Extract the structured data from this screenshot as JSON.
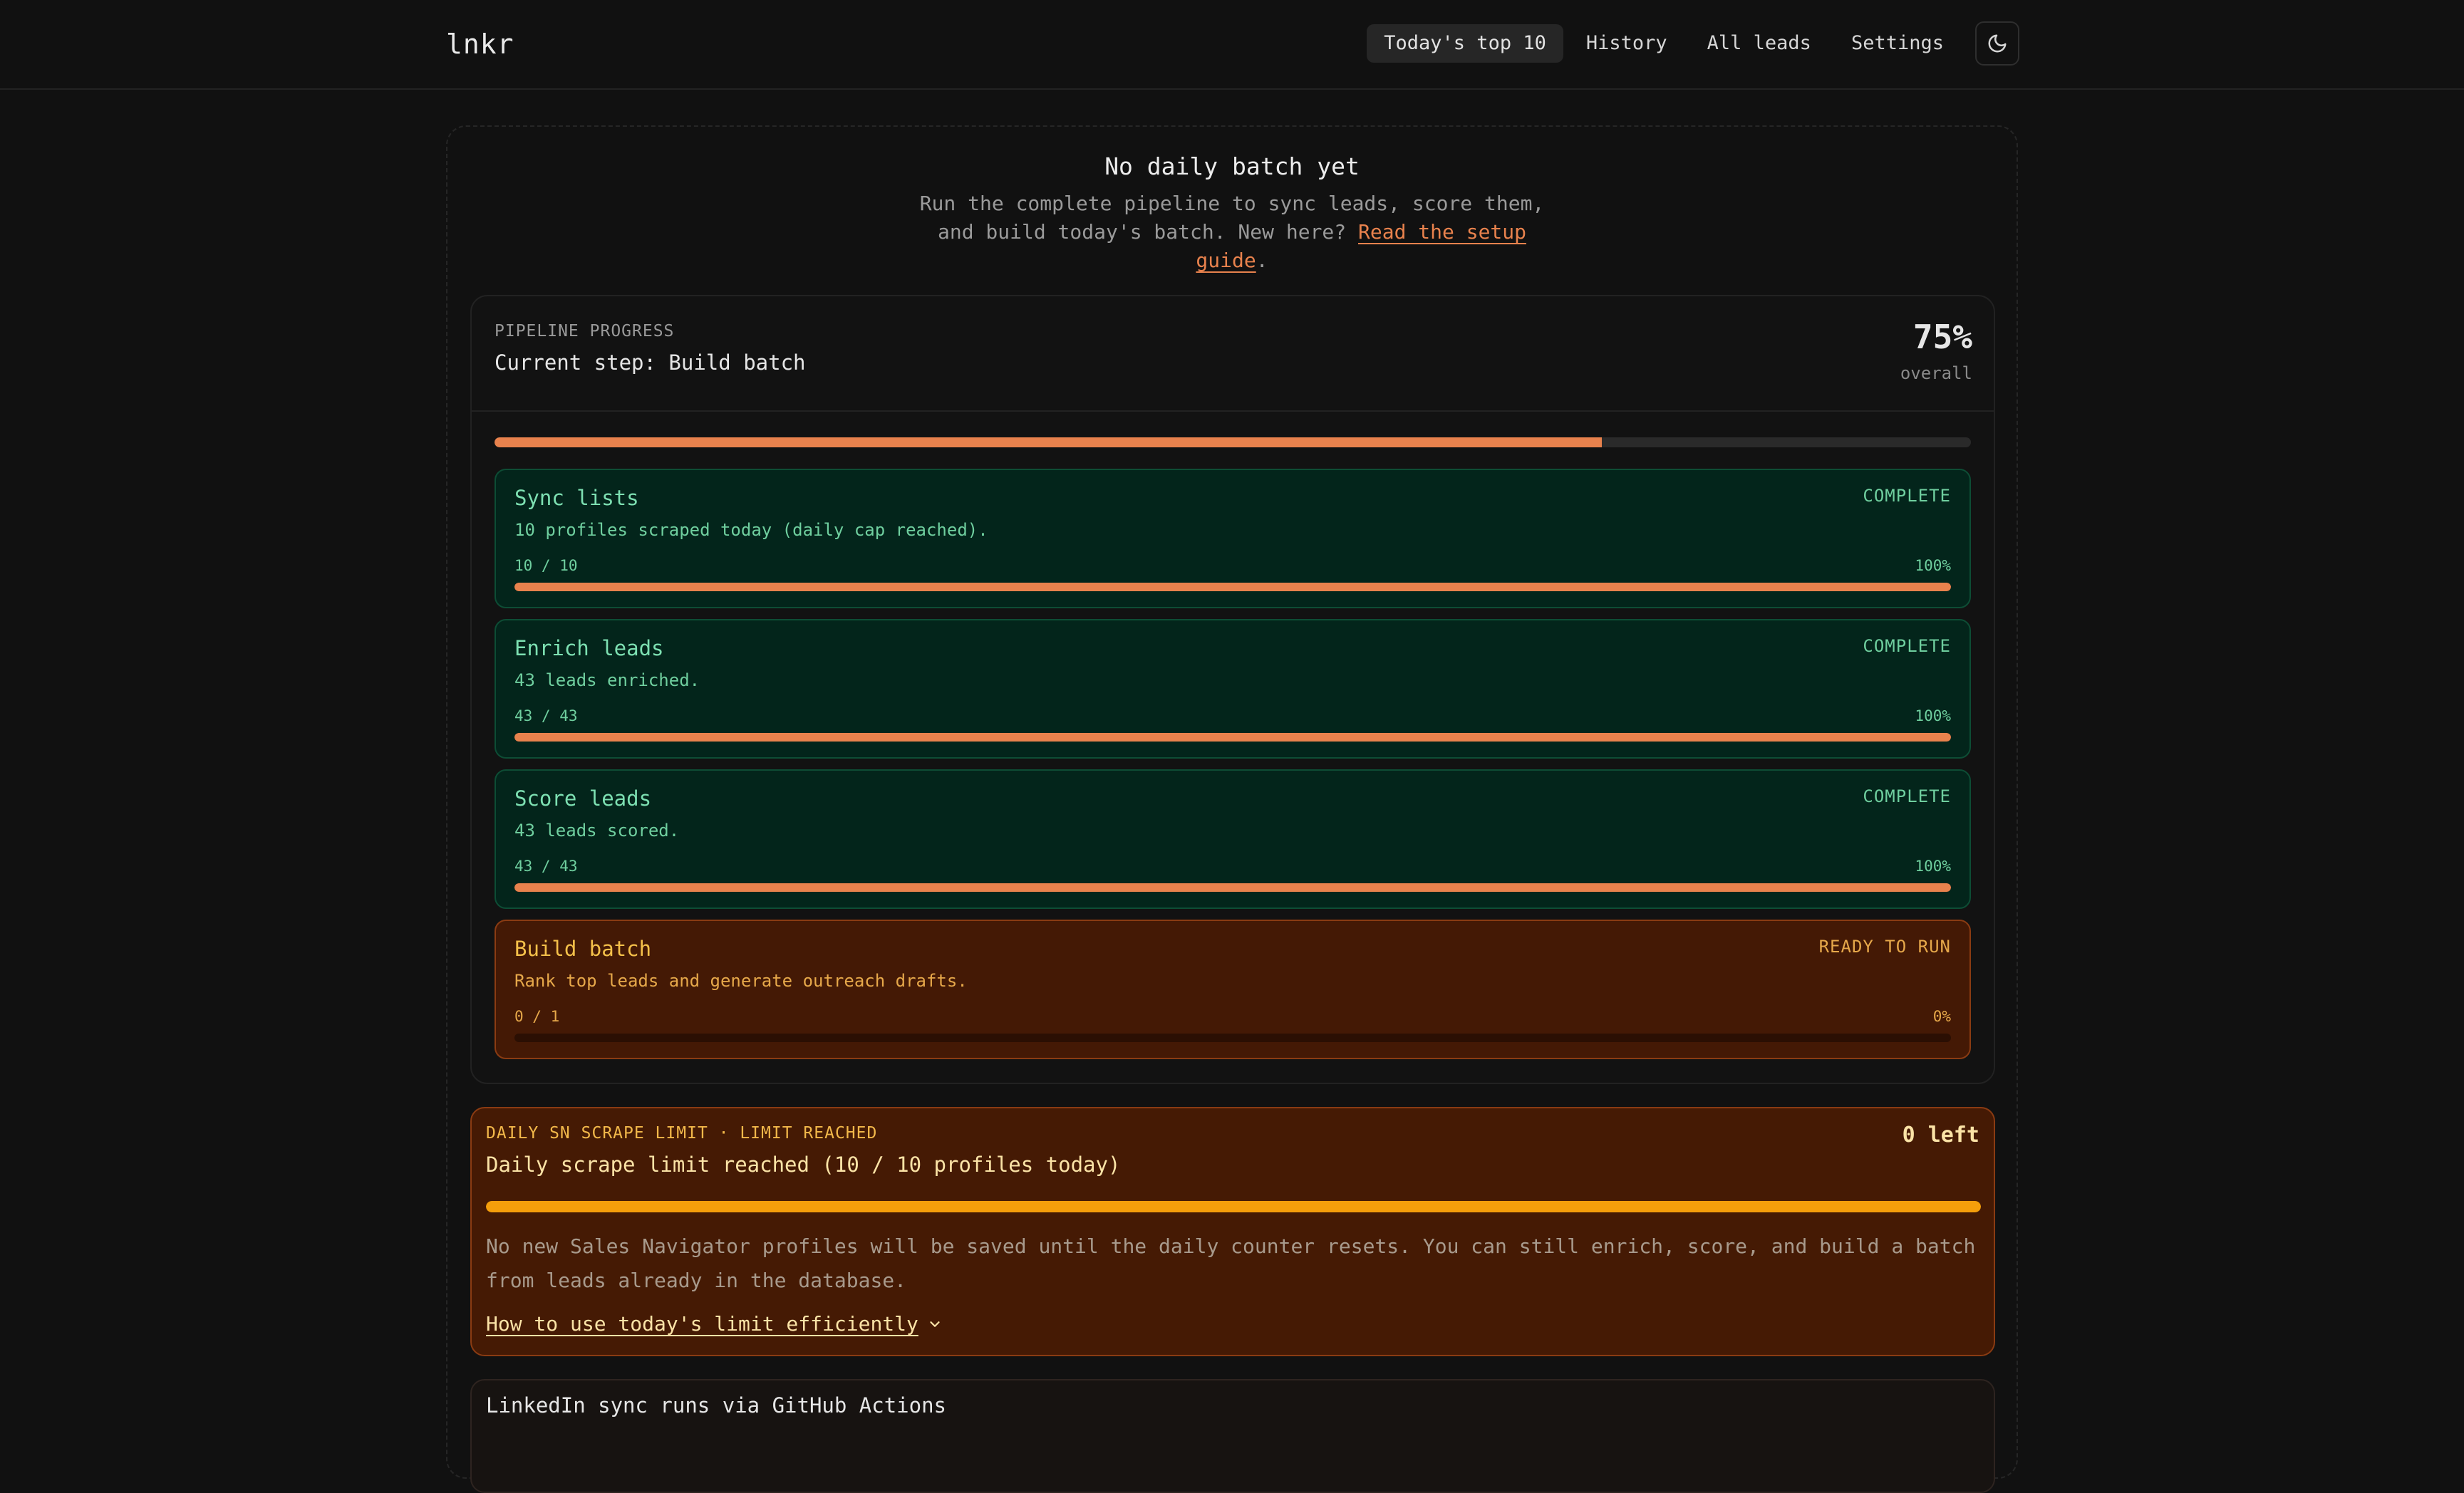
{
  "header": {
    "logo": "lnkr",
    "nav": [
      {
        "label": "Today's top 10",
        "active": true
      },
      {
        "label": "History",
        "active": false
      },
      {
        "label": "All leads",
        "active": false
      },
      {
        "label": "Settings",
        "active": false
      }
    ],
    "theme_icon": "moon-icon"
  },
  "hero": {
    "title": "No daily batch yet",
    "text_line1": "Run the complete pipeline to sync leads, score them,",
    "text_line2": "and build today's batch. New here?",
    "link_text_a": "Read the setup",
    "link_text_b": "guide",
    "link_suffix": "."
  },
  "pipeline": {
    "label": "PIPELINE PROGRESS",
    "current_step": "Current step: Build batch",
    "overall_percent": "75%",
    "overall_label": "overall",
    "overall_fraction": 0.75,
    "steps": [
      {
        "title": "Sync lists",
        "status": "COMPLETE",
        "desc": "10 profiles scraped today (daily cap reached).",
        "count": "10 / 10",
        "pct": "100%",
        "fraction": 1.0
      },
      {
        "title": "Enrich leads",
        "status": "COMPLETE",
        "desc": "43 leads enriched.",
        "count": "43 / 43",
        "pct": "100%",
        "fraction": 1.0
      },
      {
        "title": "Score leads",
        "status": "COMPLETE",
        "desc": "43 leads scored.",
        "count": "43 / 43",
        "pct": "100%",
        "fraction": 1.0
      },
      {
        "title": "Build batch",
        "status": "READY TO RUN",
        "desc": "Rank top leads and generate outreach drafts.",
        "count": "0 / 1",
        "pct": "0%",
        "fraction": 0.0
      }
    ]
  },
  "limit": {
    "label": "DAILY SN SCRAPE LIMIT · LIMIT REACHED",
    "left": "0 left",
    "title": "Daily scrape limit reached (10 / 10 profiles today)",
    "fraction": 1.0,
    "body_line1": "No new Sales Navigator profiles will be saved until the daily counter resets. You can still enrich, score, and build a batch",
    "body_line2": "from leads already in the database.",
    "howto": "How to use today's limit efficiently"
  },
  "github": {
    "title": "LinkedIn sync runs via GitHub Actions"
  },
  "colors": {
    "accent": "#e8824d",
    "complete_bg": "#03251b",
    "complete_text": "#6fcf9f",
    "warning_bg": "#451a04",
    "warning_bar": "#f59e0b"
  }
}
